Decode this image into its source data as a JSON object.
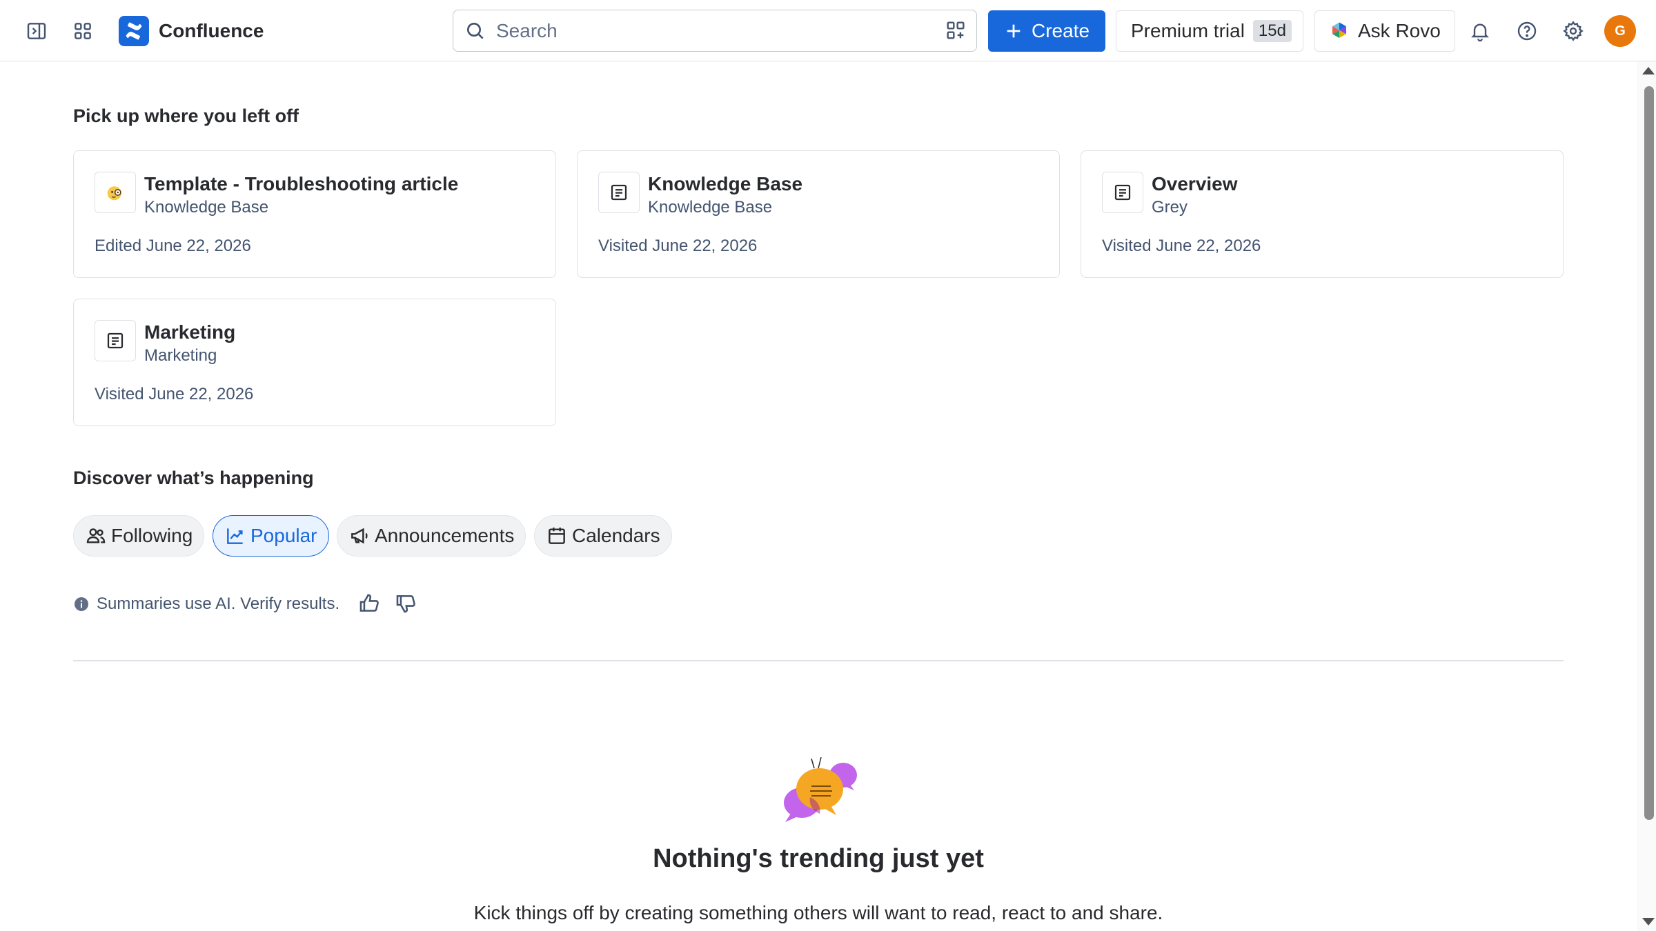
{
  "header": {
    "app_name": "Confluence",
    "search_placeholder": "Search",
    "create_label": "Create",
    "premium_trial_label": "Premium trial",
    "premium_trial_badge": "15d",
    "ask_rovo_label": "Ask Rovo",
    "avatar_initial": "G",
    "avatar_color": "#e8780b",
    "brand_color": "#1868db",
    "icons": [
      "sidebar-toggle-icon",
      "app-switcher-icon",
      "search-icon",
      "qr-code-icon",
      "plus-icon",
      "rovo-icon",
      "bell-icon",
      "help-icon",
      "gear-icon"
    ]
  },
  "recent": {
    "heading": "Pick up where you left off",
    "cards": [
      {
        "title": "Template - Troubleshooting article",
        "space": "Knowledge Base",
        "meta": "Edited June 22, 2026",
        "icon": "emoji-magnifier-face-icon"
      },
      {
        "title": "Knowledge Base",
        "space": "Knowledge Base",
        "meta": "Visited June 22, 2026",
        "icon": "page-icon"
      },
      {
        "title": "Overview",
        "space": "Grey",
        "meta": "Visited June 22, 2026",
        "icon": "page-icon"
      },
      {
        "title": "Marketing",
        "space": "Marketing",
        "meta": "Visited June 22, 2026",
        "icon": "page-icon"
      }
    ]
  },
  "discover": {
    "heading": "Discover what’s happening",
    "tabs": [
      {
        "label": "Following",
        "icon": "people-icon",
        "active": false
      },
      {
        "label": "Popular",
        "icon": "trending-chart-icon",
        "active": true
      },
      {
        "label": "Announcements",
        "icon": "megaphone-icon",
        "active": false
      },
      {
        "label": "Calendars",
        "icon": "calendar-icon",
        "active": false
      }
    ],
    "ai_note": "Summaries use AI. Verify results.",
    "empty_title": "Nothing's trending just yet",
    "empty_description": "Kick things off by creating something others will want to read, react to and share."
  }
}
